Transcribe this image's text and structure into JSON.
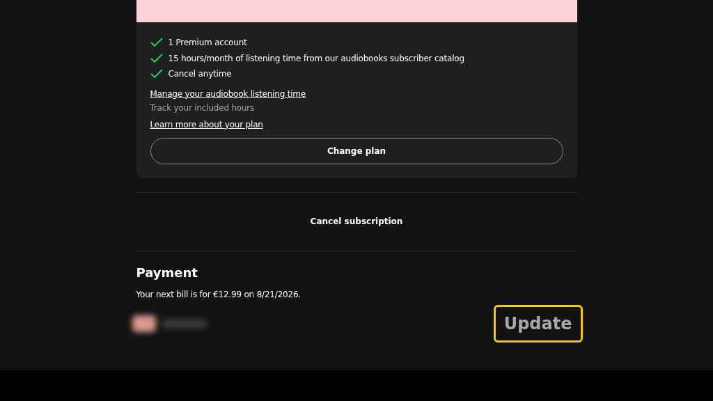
{
  "plan": {
    "features": [
      {
        "text": "1 Premium account"
      },
      {
        "text": "15 hours/month of listening time from our audiobooks subscriber catalog"
      },
      {
        "text": "Cancel anytime"
      }
    ],
    "manage_link": "Manage your audiobook listening time",
    "manage_hint": "Track your included hours",
    "learn_link": "Learn more about your plan",
    "change_button": "Change plan"
  },
  "cancel_button": "Cancel subscription",
  "payment": {
    "title": "Payment",
    "next_bill": "Your next bill is for €12.99 on 8/21/2026.",
    "update_button": {
      "label": "Update",
      "highlighted": true
    }
  }
}
